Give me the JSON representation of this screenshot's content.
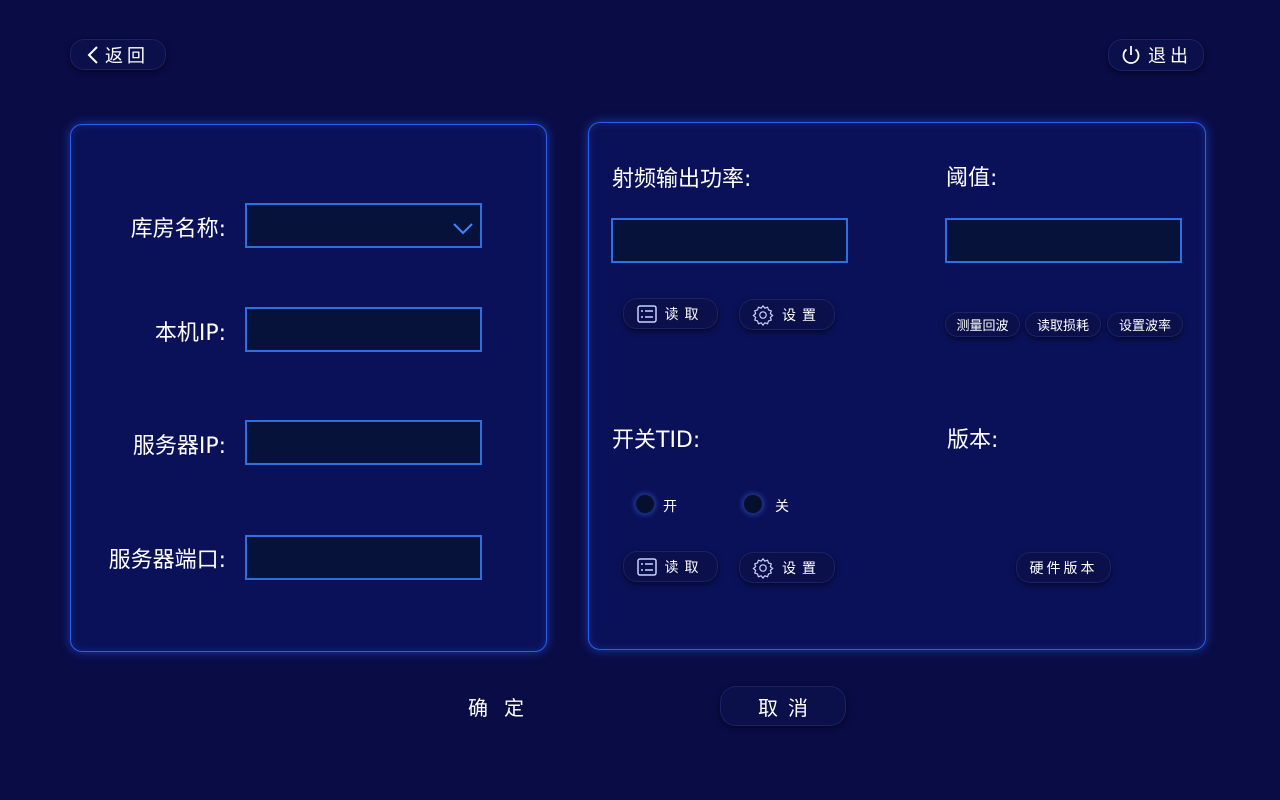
{
  "header": {
    "back_label": "返回",
    "exit_label": "退出"
  },
  "left_panel": {
    "warehouse_label": "库房名称:",
    "local_ip_label": "本机IP:",
    "server_ip_label": "服务器IP:",
    "server_port_label": "服务器端口:",
    "warehouse_value": "",
    "local_ip_value": "",
    "server_ip_value": "",
    "server_port_value": ""
  },
  "right_panel": {
    "rf_power_label": "射频输出功率:",
    "threshold_label": "阈值:",
    "rf_power_value": "",
    "threshold_value": "",
    "read_label": "读取",
    "set_label": "设置",
    "measure_echo_label": "测量回波",
    "read_loss_label": "读取损耗",
    "set_baud_label": "设置波率",
    "tid_label": "开关TID:",
    "tid_on_label": "开",
    "tid_off_label": "关",
    "version_label": "版本:",
    "hw_version_label": "硬件版本"
  },
  "footer": {
    "confirm_label": "确定",
    "cancel_label": "取消"
  },
  "colors": {
    "background": "#0a0c45",
    "panel": "#0b1158",
    "accent": "#2f6fe0",
    "field": "#07123a"
  }
}
